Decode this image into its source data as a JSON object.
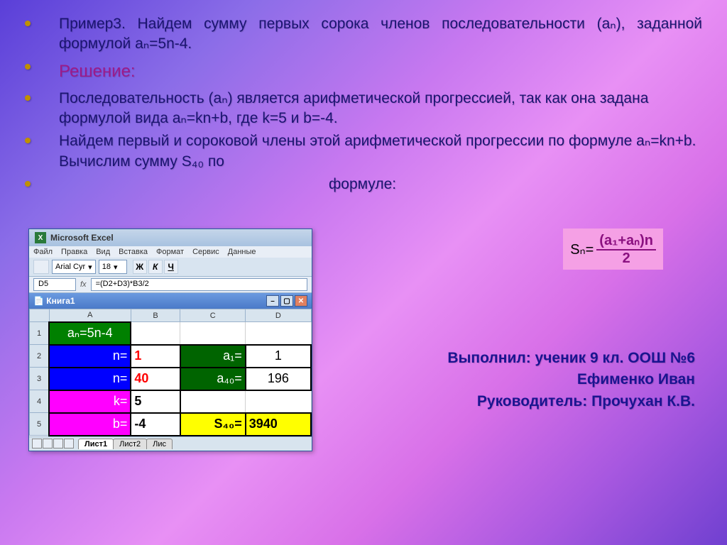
{
  "bullets": {
    "b1": "Пример3. Найдем сумму первых сорока членов последовательности (aₙ), заданной формулой aₙ=5n-4.",
    "b2_header": "Решение:",
    "b3": "Последовательность (aₙ) является арифметической прогрессией, так как она задана формулой вида aₙ=kn+b, где k=5 и b=-4.",
    "b4": "Найдем первый и сороковой члены этой арифметической прогрессии по формуле aₙ=kn+b. Вычислим сумму S₄₀ по",
    "b5": "формуле:"
  },
  "formula": {
    "sn": "Sₙ=",
    "num": "(a₁+aₙ)n",
    "den": "2"
  },
  "credits": {
    "line1": "Выполнил: ученик 9 кл. ООШ №6",
    "line2": "Ефименко Иван",
    "line3": "Руководитель: Прочухан К.В."
  },
  "excel": {
    "title": "Microsoft Excel",
    "menu": {
      "file": "Файл",
      "edit": "Правка",
      "view": "Вид",
      "insert": "Вставка",
      "format": "Формат",
      "service": "Сервис",
      "data": "Данные"
    },
    "font": {
      "name": "Arial Cyr",
      "size": "18",
      "bold": "Ж",
      "italic": "К",
      "underline": "Ч"
    },
    "namebox": "D5",
    "fx": "fx",
    "formula_value": "=(D2+D3)*B3/2",
    "workbook": "Книга1",
    "headers": {
      "A": "A",
      "B": "B",
      "C": "C",
      "D": "D"
    },
    "rows": {
      "r1": {
        "A": "aₙ=5n-4"
      },
      "r2": {
        "A": "n=",
        "B": "1",
        "C": "a₁=",
        "D": "1"
      },
      "r3": {
        "A": "n=",
        "B": "40",
        "C": "a₄₀=",
        "D": "196"
      },
      "r4": {
        "A": "k=",
        "B": "5"
      },
      "r5": {
        "A": "b=",
        "B": "-4",
        "C": "S₄₀=",
        "D": "3940"
      }
    },
    "tabs": {
      "t1": "Лист1",
      "t2": "Лист2",
      "t3": "Лис"
    }
  }
}
